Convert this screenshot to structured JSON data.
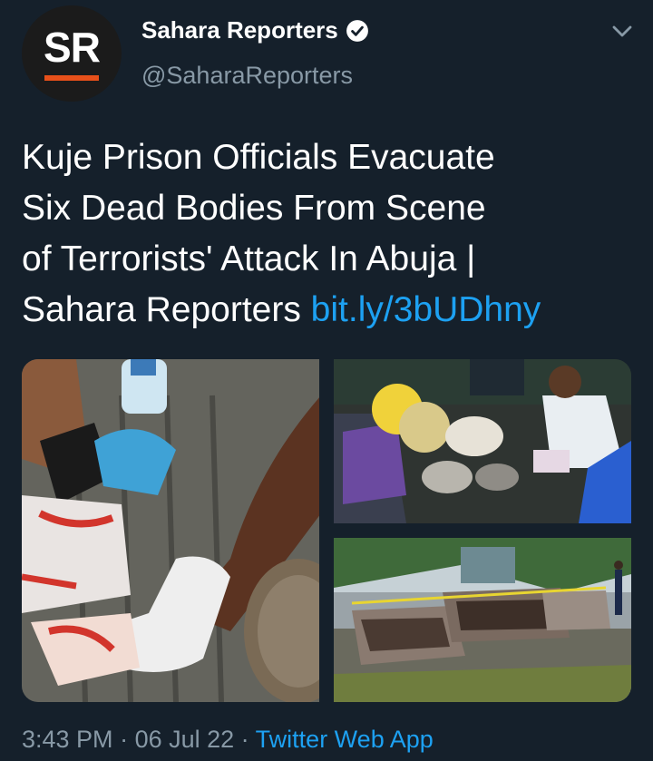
{
  "account": {
    "avatar_text": "SR",
    "display_name": "Sahara Reporters",
    "handle": "@SaharaReporters",
    "verified": true
  },
  "tweet": {
    "lines": [
      "Kuje Prison Officials Evacuate",
      "Six Dead Bodies From Scene",
      "of Terrorists' Attack In Abuja |",
      "Sahara Reporters "
    ],
    "link": "bit.ly/3bUDhny"
  },
  "media": {
    "photos": [
      "gloved-hands-photo",
      "officials-in-truck-photo",
      "burnt-cars-photo"
    ]
  },
  "meta": {
    "time": "3:43 PM",
    "separator": " · ",
    "date": "06 Jul 22",
    "source": "Twitter Web App"
  },
  "colors": {
    "background": "#15202b",
    "text": "#ffffff",
    "secondary": "#8899a6",
    "link": "#1da1f2",
    "logo_accent": "#e8501a"
  },
  "icons": [
    "verified-badge-icon",
    "chevron-down-icon"
  ]
}
